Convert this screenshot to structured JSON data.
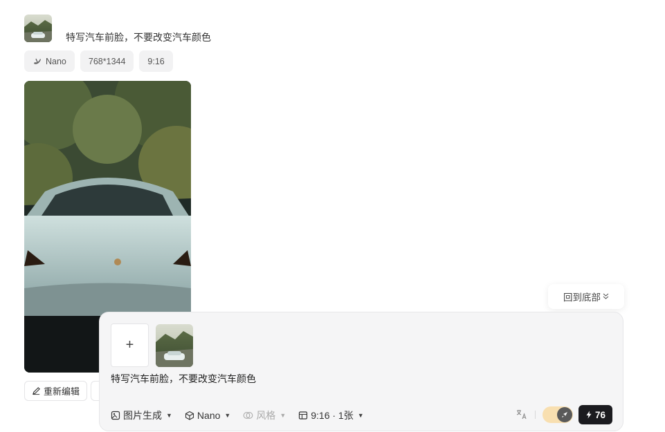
{
  "message": {
    "prompt": "特写汽车前脸，不要改变汽车颜色",
    "tags": [
      {
        "label": "Nano",
        "icon": "banana-icon"
      },
      {
        "label": "768*1344"
      },
      {
        "label": "9:16"
      }
    ]
  },
  "actions": {
    "re_edit_label": "重新编辑"
  },
  "scroll": {
    "to_bottom_label": "回到底部"
  },
  "composer": {
    "add_label": "+",
    "text": "特写汽车前脸，不要改变汽车颜色",
    "tools": {
      "mode_label": "图片生成",
      "model_label": "Nano",
      "style_label": "风格",
      "ratio_label": "9:16 · 1张"
    },
    "credits": "76"
  },
  "colors": {
    "accent_toggle": "#f8dfb0",
    "credits_bg": "#1b1b1f"
  }
}
